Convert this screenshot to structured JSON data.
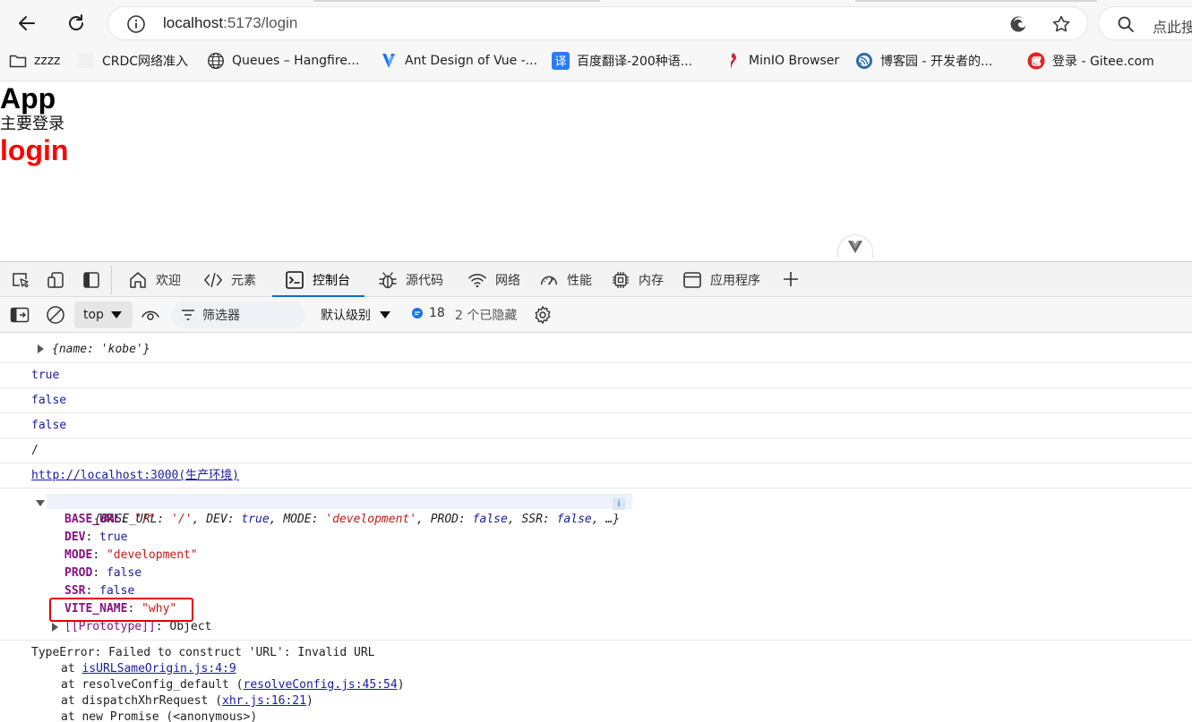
{
  "browser": {
    "back_icon": "arrow-left-icon",
    "reload_icon": "reload-icon",
    "url_host": "localhost",
    "url_path": ":5173/login",
    "search_placeholder": "点此搜",
    "bookmarks": [
      {
        "label": "zzzz",
        "icon": "folder-icon"
      },
      {
        "label": "CRDC网络准入",
        "icon": "page-icon"
      },
      {
        "label": "Queues – Hangfire...",
        "icon": "globe-icon"
      },
      {
        "label": "Ant Design of Vue -...",
        "icon": "antd-icon"
      },
      {
        "label": "百度翻译-200种语...",
        "icon": "translate-icon"
      },
      {
        "label": "MinIO Browser",
        "icon": "minio-icon"
      },
      {
        "label": "博客园 - 开发者的...",
        "icon": "cnblogs-icon"
      },
      {
        "label": "登录 - Gitee.com",
        "icon": "gitee-icon"
      }
    ]
  },
  "page": {
    "title": "App",
    "subtitle": "主要登录",
    "route_label": "login"
  },
  "devtools": {
    "tabs": [
      {
        "label": "欢迎",
        "icon": "home-icon"
      },
      {
        "label": "元素",
        "icon": "code-icon"
      },
      {
        "label": "控制台",
        "icon": "console-icon",
        "active": true
      },
      {
        "label": "源代码",
        "icon": "bug-icon"
      },
      {
        "label": "网络",
        "icon": "wifi-icon"
      },
      {
        "label": "性能",
        "icon": "gauge-icon"
      },
      {
        "label": "内存",
        "icon": "chip-icon"
      },
      {
        "label": "应用程序",
        "icon": "window-icon"
      }
    ],
    "console_toolbar": {
      "context": "top",
      "filter_placeholder": "筛选器",
      "level": "默认级别",
      "message_count": "18",
      "hidden": "2 个已隐藏"
    },
    "console": {
      "line1": "{name: 'kobe'}",
      "line2": "true",
      "line3": "false",
      "line4": "false",
      "line5": "/",
      "line6_link": "http://localhost:3000(生产环境)",
      "env_summary": {
        "open": "{",
        "k1": "BASE_URL",
        "v1": "'/'",
        "k2": "DEV",
        "v2": "true",
        "k3": "MODE",
        "v3": "'development'",
        "k4": "PROD",
        "v4": "false",
        "k5": "SSR",
        "v5": "false",
        "close": ", …}",
        "badge": "i"
      },
      "env_props": [
        {
          "key": "BASE_URL",
          "value": "\"/\""
        },
        {
          "key": "DEV",
          "value": "true"
        },
        {
          "key": "MODE",
          "value": "\"development\""
        },
        {
          "key": "PROD",
          "value": "false"
        },
        {
          "key": "SSR",
          "value": "false"
        },
        {
          "key": "VITE_NAME",
          "value": "\"why\""
        }
      ],
      "prototype_key": "[[Prototype]]",
      "prototype_value": "Object",
      "error": {
        "message": "TypeError: Failed to construct 'URL': Invalid URL",
        "frames": [
          {
            "prefix": "at ",
            "fn": "",
            "link": "isURLSameOrigin.js:4:9",
            "suffix": ""
          },
          {
            "prefix": "at ",
            "fn": "resolveConfig_default (",
            "link": "resolveConfig.js:45:54",
            "suffix": ")"
          },
          {
            "prefix": "at ",
            "fn": "dispatchXhrRequest (",
            "link": "xhr.js:16:21",
            "suffix": ")"
          },
          {
            "prefix": "at ",
            "fn": "new Promise (<anonymous>)",
            "link": "",
            "suffix": ""
          }
        ]
      }
    }
  },
  "colors": {
    "accent": "#0a6ccf",
    "login_red": "#ff0000",
    "highlight_red": "#e50000",
    "console_keyword": "#1a1aa6",
    "console_string": "#c41a16",
    "console_prop": "#881280"
  }
}
